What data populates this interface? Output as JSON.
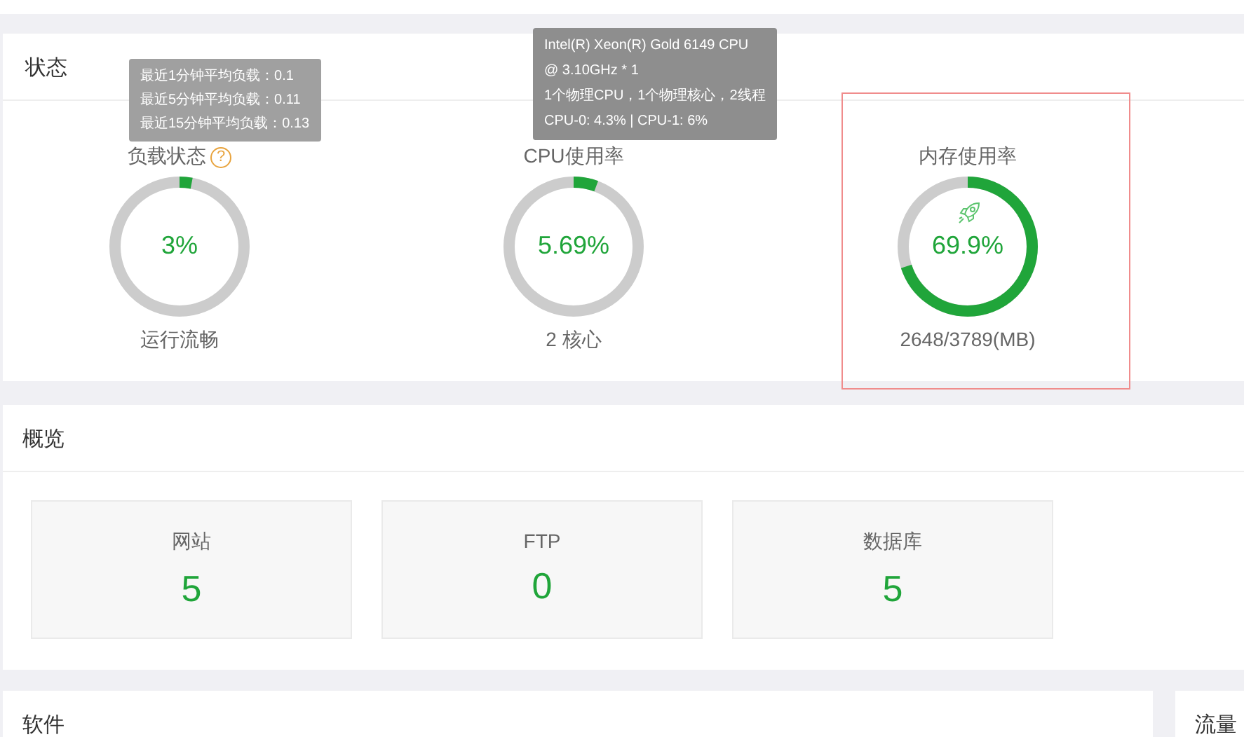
{
  "status_panel": {
    "title": "状态",
    "gauges": [
      {
        "kind": "load",
        "label": "负载状态",
        "help_mark": "?",
        "level": 0.03,
        "value": "3%",
        "caption": "运行流畅",
        "highlighted": false,
        "tooltip": [
          "最近1分钟平均负载：0.1",
          "最近5分钟平均负载：0.11",
          "最近15分钟平均负载：0.13"
        ]
      },
      {
        "kind": "cpu",
        "label": "CPU使用率",
        "level": 0.0569,
        "value": "5.69%",
        "caption": "2 核心",
        "highlighted": false,
        "tooltip": [
          "Intel(R) Xeon(R) Gold 6149 CPU",
          "@ 3.10GHz * 1",
          "1个物理CPU，1个物理核心，2线程",
          "CPU-0: 4.3% | CPU-1: 6%"
        ]
      },
      {
        "kind": "memory",
        "label": "内存使用率",
        "level": 0.699,
        "value": "69.9%",
        "caption": "2648/3789(MB)",
        "highlighted": true
      }
    ]
  },
  "overview_panel": {
    "title": "概览",
    "cards": [
      {
        "label": "网站",
        "value": "5"
      },
      {
        "label": "FTP",
        "value": "0"
      },
      {
        "label": "数据库",
        "value": "5"
      }
    ]
  },
  "bottom_panels": [
    {
      "title": "软件"
    },
    {
      "title": "流量"
    }
  ]
}
